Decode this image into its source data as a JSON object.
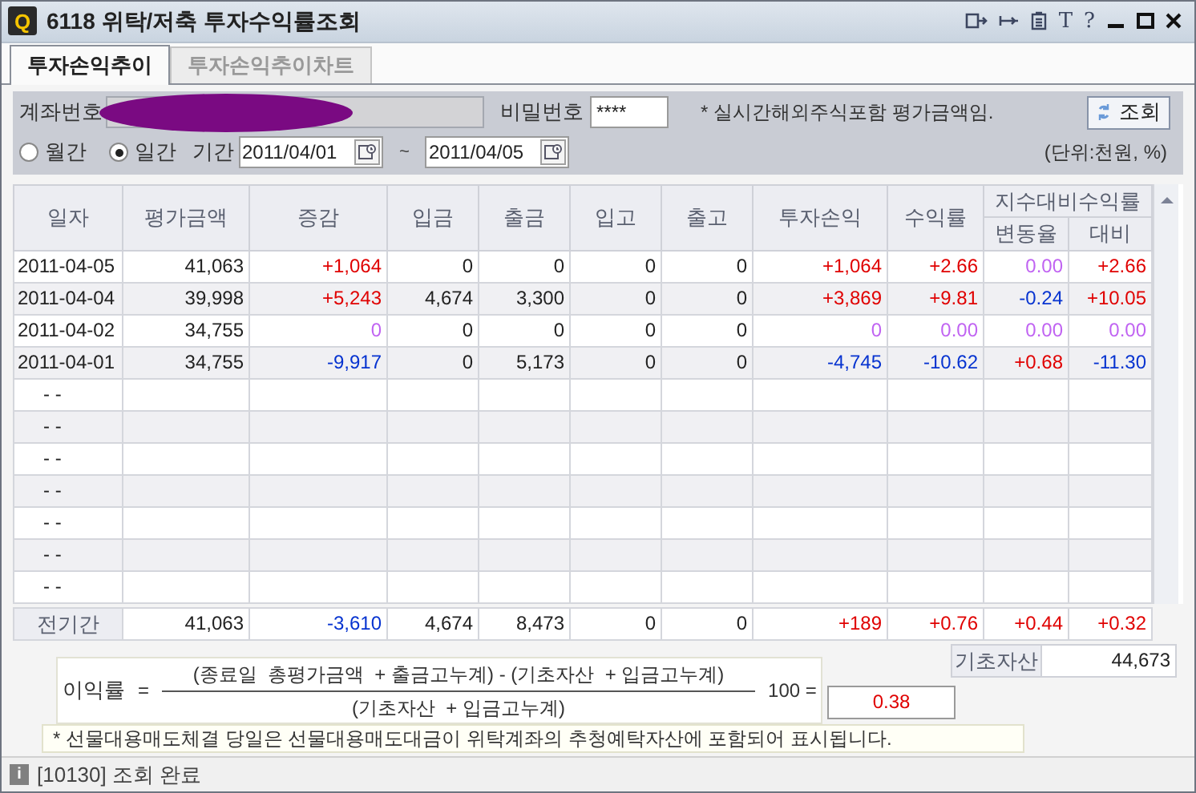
{
  "window": {
    "logo": "Q",
    "title": "6118 위탁/저축 투자수익률조회",
    "tools": [
      "T",
      "?"
    ]
  },
  "tabs": [
    {
      "label": "투자손익추이",
      "selected": true
    },
    {
      "label": "투자손익추이차트",
      "selected": false
    }
  ],
  "query": {
    "account_label": "계좌번호",
    "password_label": "비밀번호",
    "password": "****",
    "note": "* 실시간해외주식포함 평가금액임.",
    "search_button": "조회",
    "periods": [
      {
        "label": "월간",
        "selected": false
      },
      {
        "label": "일간",
        "selected": true
      }
    ],
    "period_label": "기간",
    "from": "2011/04/01",
    "separator": "~",
    "to": "2011/04/05",
    "unit": "(단위:천원, %)"
  },
  "table": {
    "columns": [
      "일자",
      "평가금액",
      "증감",
      "입금",
      "출금",
      "입고",
      "출고",
      "투자손익",
      "수익률"
    ],
    "index_group": {
      "label": "지수대비수익률",
      "columns": [
        "변동율",
        "대비"
      ]
    },
    "rows": [
      {
        "cells": [
          "2011-04-05",
          "41,063",
          {
            "text": "+1,064",
            "color": "#e00000"
          },
          "0",
          "0",
          "0",
          "0",
          {
            "text": "+1,064",
            "color": "#e00000"
          },
          {
            "text": "+2.66",
            "color": "#e00000"
          },
          {
            "text": "0.00",
            "color": "#c063f2"
          },
          {
            "text": "+2.66",
            "color": "#e00000"
          }
        ]
      },
      {
        "cells": [
          "2011-04-04",
          "39,998",
          {
            "text": "+5,243",
            "color": "#e00000"
          },
          "4,674",
          "3,300",
          "0",
          "0",
          {
            "text": "+3,869",
            "color": "#e00000"
          },
          {
            "text": "+9.81",
            "color": "#e00000"
          },
          {
            "text": "-0.24",
            "color": "#0633d0"
          },
          {
            "text": "+10.05",
            "color": "#e00000"
          }
        ]
      },
      {
        "cells": [
          "2011-04-02",
          "34,755",
          {
            "text": "0",
            "color": "#c063f2"
          },
          "0",
          "0",
          "0",
          "0",
          {
            "text": "0",
            "color": "#c063f2"
          },
          {
            "text": "0.00",
            "color": "#c063f2"
          },
          {
            "text": "0.00",
            "color": "#c063f2"
          },
          {
            "text": "0.00",
            "color": "#c063f2"
          }
        ]
      },
      {
        "cells": [
          "2011-04-01",
          "34,755",
          {
            "text": "-9,917",
            "color": "#0633d0"
          },
          "0",
          "5,173",
          "0",
          "0",
          {
            "text": "-4,745",
            "color": "#0633d0"
          },
          {
            "text": "-10.62",
            "color": "#0633d0"
          },
          {
            "text": "+0.68",
            "color": "#e00000"
          },
          {
            "text": "-11.30",
            "color": "#0633d0"
          }
        ]
      },
      {
        "cells": [
          "- -"
        ]
      },
      {
        "cells": [
          "- -"
        ]
      },
      {
        "cells": [
          "- -"
        ]
      },
      {
        "cells": [
          "- -"
        ]
      },
      {
        "cells": [
          "- -"
        ]
      },
      {
        "cells": [
          "- -"
        ]
      },
      {
        "cells": [
          "- -"
        ]
      }
    ],
    "total_row": {
      "cells": [
        "전기간",
        "41,063",
        {
          "text": "-3,610",
          "color": "#0633d0"
        },
        "4,674",
        "8,473",
        "0",
        "0",
        {
          "text": "+189",
          "color": "#e00000"
        },
        {
          "text": "+0.76",
          "color": "#e00000"
        },
        {
          "text": "+0.44",
          "color": "#e00000"
        },
        {
          "text": "+0.32",
          "color": "#e00000"
        }
      ]
    }
  },
  "base_asset": {
    "label": "기초자산",
    "value": "44,673"
  },
  "formula": {
    "lhs": "이익률",
    "eq": "=",
    "numerator": "(종료일  총평가금액  + 출금고누계) - (기초자산  + 입금고누계)",
    "denominator": "(기초자산  + 입금고누계)",
    "times": "100 =",
    "result": {
      "text": "0.38",
      "color": "#e00000"
    }
  },
  "notice": "* 선물대용매도체결 당일은 선물대용매도대금이 위탁계좌의 추청예탁자산에 포함되어 표시됩니다.",
  "status": {
    "icon": "i",
    "message": "[10130] 조회 완료"
  }
}
